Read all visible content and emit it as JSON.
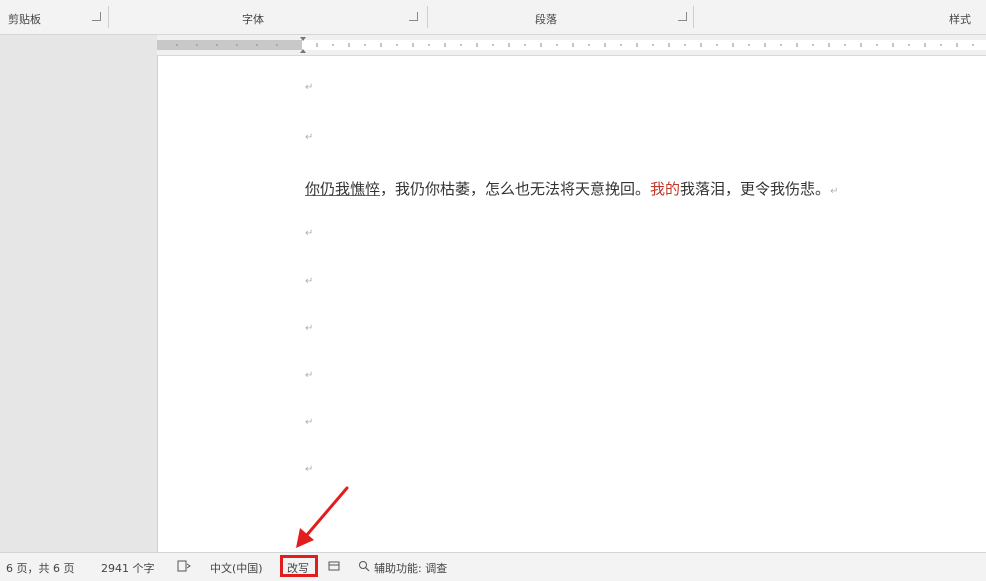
{
  "ribbon": {
    "groups": [
      {
        "label": "剪贴板"
      },
      {
        "label": "字体"
      },
      {
        "label": "段落"
      },
      {
        "label": "样式"
      }
    ]
  },
  "document": {
    "paragraph_mark": "↵",
    "text": {
      "underlined": "你仍我憔悴",
      "part1": "，我仍你枯萎，怎么也无法将天意挽回。",
      "red": "我的",
      "part2": "我落泪，更令我伤悲。"
    }
  },
  "statusbar": {
    "page_info": "6 页，共 6 页",
    "word_count": "2941 个字",
    "language": "中文(中国)",
    "overtype": "改写",
    "accessibility": "辅助功能: 调查"
  },
  "colors": {
    "annotation": "#e01e1e",
    "red_text": "#c0392b"
  }
}
